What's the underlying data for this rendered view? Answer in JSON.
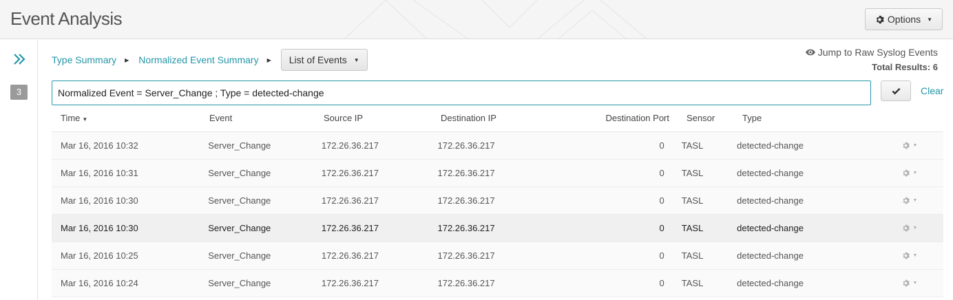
{
  "header": {
    "title": "Event Analysis",
    "options_label": "Options"
  },
  "rail": {
    "badge": "3"
  },
  "breadcrumb": {
    "items": [
      {
        "label": "Type Summary"
      },
      {
        "label": "Normalized Event Summary"
      }
    ],
    "current": "List of Events"
  },
  "summary": {
    "raw_link": "Jump to Raw Syslog Events",
    "total_results": "Total Results: 6"
  },
  "filter": {
    "value": "Normalized Event = Server_Change ; Type = detected-change",
    "clear_label": "Clear"
  },
  "table": {
    "columns": [
      "Time",
      "Event",
      "Source IP",
      "Destination IP",
      "Destination Port",
      "Sensor",
      "Type"
    ],
    "rows": [
      [
        "Mar 16, 2016 10:32",
        "Server_Change",
        "172.26.36.217",
        "172.26.36.217",
        "0",
        "TASL",
        "detected-change"
      ],
      [
        "Mar 16, 2016 10:31",
        "Server_Change",
        "172.26.36.217",
        "172.26.36.217",
        "0",
        "TASL",
        "detected-change"
      ],
      [
        "Mar 16, 2016 10:30",
        "Server_Change",
        "172.26.36.217",
        "172.26.36.217",
        "0",
        "TASL",
        "detected-change"
      ],
      [
        "Mar 16, 2016 10:30",
        "Server_Change",
        "172.26.36.217",
        "172.26.36.217",
        "0",
        "TASL",
        "detected-change"
      ],
      [
        "Mar 16, 2016 10:25",
        "Server_Change",
        "172.26.36.217",
        "172.26.36.217",
        "0",
        "TASL",
        "detected-change"
      ],
      [
        "Mar 16, 2016 10:24",
        "Server_Change",
        "172.26.36.217",
        "172.26.36.217",
        "0",
        "TASL",
        "detected-change"
      ]
    ],
    "hover_row": 3
  },
  "colors": {
    "accent": "#2596a8",
    "header_bg": "#f5f5f5",
    "row_bg": "#fafafa",
    "row_hover_bg": "#f0f0f0"
  },
  "icons": {
    "options": "gear-icon",
    "rail_expand": "double-chevron-right-icon",
    "raw_link": "eye-icon",
    "apply": "checkmark-icon",
    "row_action": "gear-icon"
  }
}
